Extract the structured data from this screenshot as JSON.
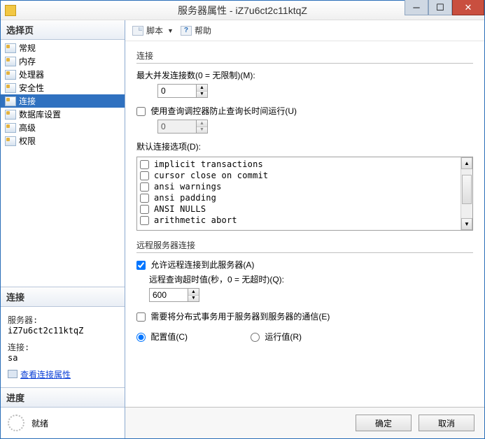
{
  "window": {
    "title": "服务器属性 - iZ7u6ct2c11ktqZ"
  },
  "sidebar": {
    "select_page_header": "选择页",
    "items": [
      {
        "label": "常规"
      },
      {
        "label": "内存"
      },
      {
        "label": "处理器"
      },
      {
        "label": "安全性"
      },
      {
        "label": "连接"
      },
      {
        "label": "数据库设置"
      },
      {
        "label": "高级"
      },
      {
        "label": "权限"
      }
    ],
    "connection_header": "连接",
    "server_label": "服务器:",
    "server_value": "iZ7u6ct2c11ktqZ",
    "conn_label": "连接:",
    "conn_value": "sa",
    "view_conn_props": "查看连接属性",
    "progress_header": "进度",
    "progress_status": "就绪"
  },
  "toolbar": {
    "script_label": "脚本",
    "help_label": "帮助"
  },
  "content": {
    "section_connections": "连接",
    "max_concurrent_label": "最大并发连接数(0 = 无限制)(M):",
    "max_concurrent_value": "0",
    "use_query_governor_label": "使用查询调控器防止查询长时间运行(U)",
    "governor_value": "0",
    "default_conn_opts_label": "默认连接选项(D):",
    "options": [
      "implicit transactions",
      "cursor close on commit",
      "ansi warnings",
      "ansi padding",
      "ANSI NULLS",
      "arithmetic abort"
    ],
    "section_remote": "远程服务器连接",
    "allow_remote_label": "允许远程连接到此服务器(A)",
    "remote_timeout_label": "远程查询超时值(秒，0 = 无超时)(Q):",
    "remote_timeout_value": "600",
    "require_dist_label": "需要将分布式事务用于服务器到服务器的通信(E)",
    "radio_configured": "配置值(C)",
    "radio_running": "运行值(R)"
  },
  "footer": {
    "ok": "确定",
    "cancel": "取消"
  }
}
